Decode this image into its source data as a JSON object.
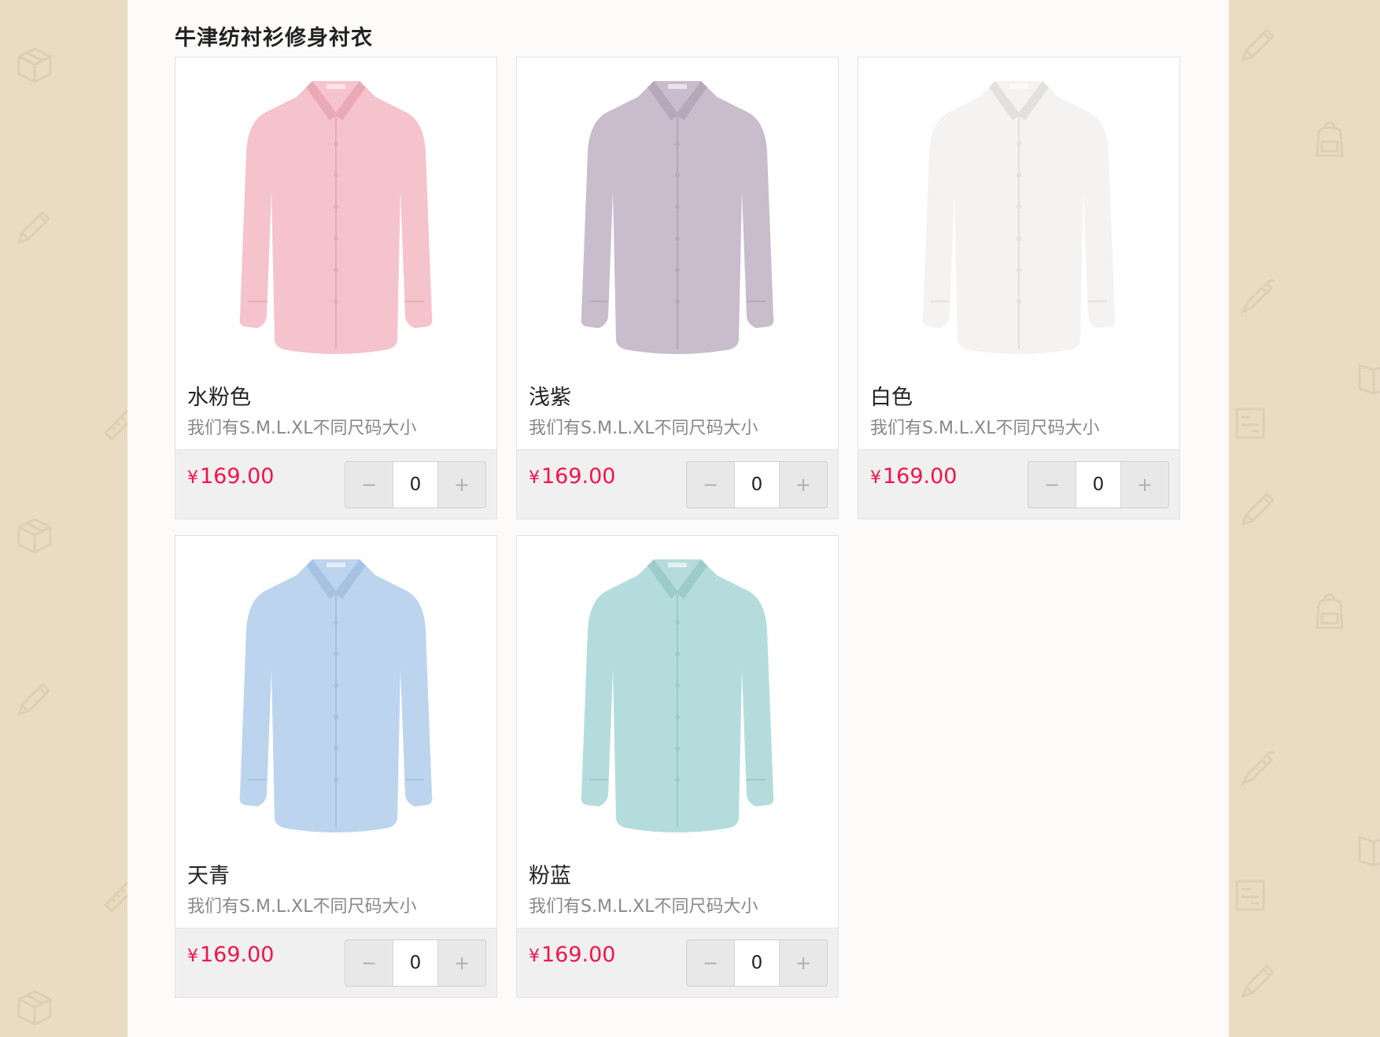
{
  "section": {
    "title": "牛津纺衬衫修身衬衣"
  },
  "products": [
    {
      "name": "水粉色",
      "desc": "我们有S.M.L.XL不同尺码大小",
      "currency": "¥",
      "price": "169.00",
      "qty": "0",
      "minus": "−",
      "plus": "+",
      "color": "#f5c3cc",
      "shade": "#e9aab6"
    },
    {
      "name": "浅紫",
      "desc": "我们有S.M.L.XL不同尺码大小",
      "currency": "¥",
      "price": "169.00",
      "qty": "0",
      "minus": "−",
      "plus": "+",
      "color": "#c8bccd",
      "shade": "#b5a8bb"
    },
    {
      "name": "白色",
      "desc": "我们有S.M.L.XL不同尺码大小",
      "currency": "¥",
      "price": "169.00",
      "qty": "0",
      "minus": "−",
      "plus": "+",
      "color": "#f4f3f1",
      "shade": "#e3e1de"
    },
    {
      "name": "天青",
      "desc": "我们有S.M.L.XL不同尺码大小",
      "currency": "¥",
      "price": "169.00",
      "qty": "0",
      "minus": "−",
      "plus": "+",
      "color": "#bcd4ee",
      "shade": "#a6c2e2"
    },
    {
      "name": "粉蓝",
      "desc": "我们有S.M.L.XL不同尺码大小",
      "currency": "¥",
      "price": "169.00",
      "qty": "0",
      "minus": "−",
      "plus": "+",
      "color": "#b5dcdc",
      "shade": "#9ccbcc"
    }
  ],
  "background": {
    "color": "#e9dcc2",
    "doodles": [
      "box-icon",
      "pencil-icon",
      "backpack-icon",
      "pen-icon",
      "book-icon",
      "ruler-icon",
      "board-icon"
    ]
  }
}
